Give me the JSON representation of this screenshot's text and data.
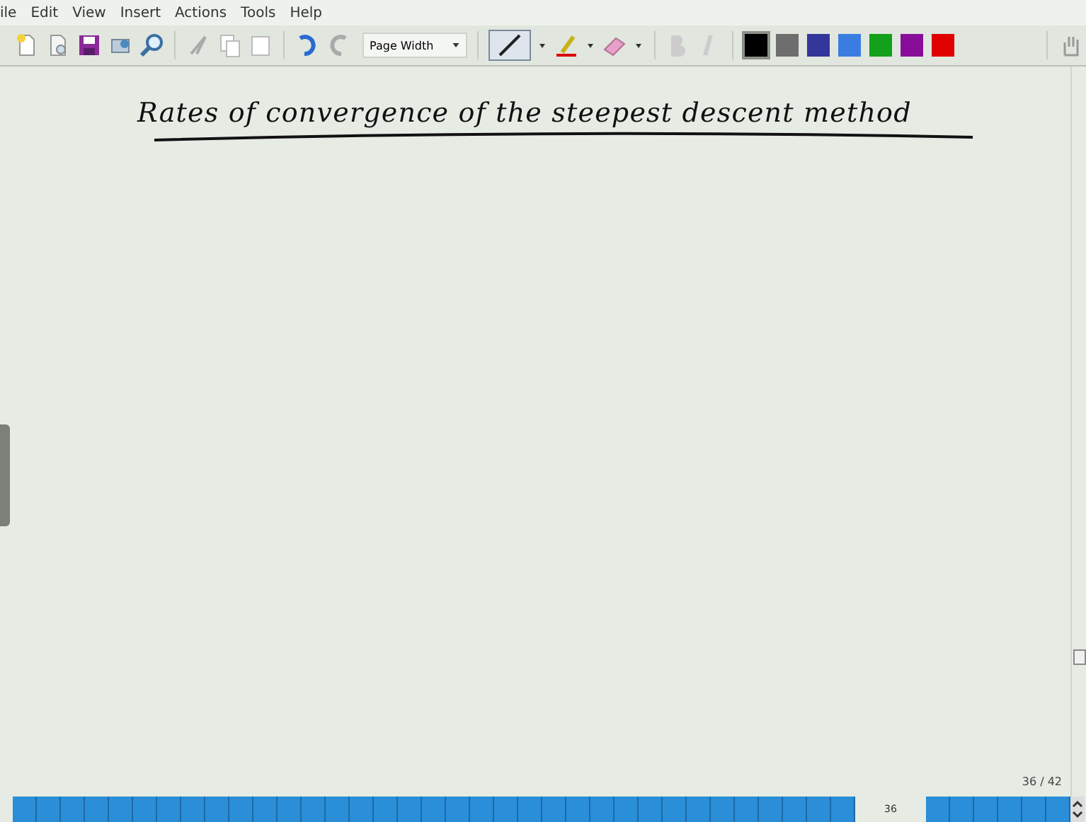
{
  "menu": [
    "ile",
    "Edit",
    "View",
    "Insert",
    "Actions",
    "Tools",
    "Help"
  ],
  "toolbar": {
    "zoom": "Page Width",
    "pen_colors": [
      {
        "color": "#000000",
        "selected": true
      },
      {
        "color": "#6e6e6e",
        "selected": false
      },
      {
        "color": "#33369a",
        "selected": false
      },
      {
        "color": "#3a7de0",
        "selected": false
      },
      {
        "color": "#13a01a",
        "selected": false
      },
      {
        "color": "#880e99",
        "selected": false
      },
      {
        "color": "#e00000",
        "selected": false
      }
    ]
  },
  "page": {
    "title": "Rates of convergence of the steepest descent method",
    "page_indicator": "36 / 42"
  },
  "page_tabs": {
    "current_label": "36",
    "pages": [
      {
        "selected": false
      },
      {
        "selected": false
      },
      {
        "selected": false
      },
      {
        "selected": false
      },
      {
        "selected": false
      },
      {
        "selected": false
      },
      {
        "selected": false
      },
      {
        "selected": false
      },
      {
        "selected": false
      },
      {
        "selected": false
      },
      {
        "selected": false
      },
      {
        "selected": false
      },
      {
        "selected": false
      },
      {
        "selected": false
      },
      {
        "selected": false
      },
      {
        "selected": false
      },
      {
        "selected": false
      },
      {
        "selected": false
      },
      {
        "selected": false
      },
      {
        "selected": false
      },
      {
        "selected": false
      },
      {
        "selected": false
      },
      {
        "selected": false
      },
      {
        "selected": false
      },
      {
        "selected": false
      },
      {
        "selected": false
      },
      {
        "selected": false
      },
      {
        "selected": false
      },
      {
        "selected": false
      },
      {
        "selected": false
      },
      {
        "selected": false
      },
      {
        "selected": false
      },
      {
        "selected": false
      },
      {
        "selected": false
      },
      {
        "selected": false
      },
      {
        "selected": true
      },
      {
        "selected": false
      },
      {
        "selected": false
      },
      {
        "selected": false
      },
      {
        "selected": false
      },
      {
        "selected": false
      },
      {
        "selected": false
      }
    ]
  }
}
